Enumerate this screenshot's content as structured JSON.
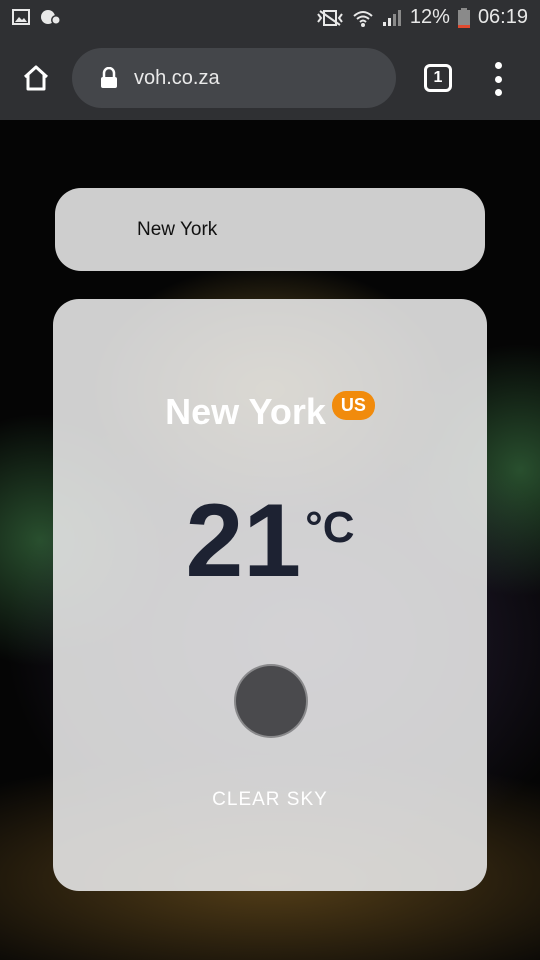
{
  "status_bar": {
    "battery": "12%",
    "time": "06:19",
    "icons": [
      "image-icon",
      "notification-icon",
      "vibrate-icon",
      "wifi-icon",
      "signal-icon",
      "battery-icon"
    ]
  },
  "browser": {
    "url": "voh.co.za",
    "tab_count": "1",
    "icons": [
      "home-icon",
      "lock-icon",
      "tabs-icon",
      "menu-icon"
    ]
  },
  "search": {
    "value": "New York"
  },
  "weather": {
    "city": "New York",
    "country": "US",
    "temperature": "21",
    "unit": "°C",
    "condition": "CLEAR SKY",
    "icon": "weather-icon"
  },
  "colors": {
    "browser_bg": "#2f3033",
    "address_bg": "#44464a",
    "badge": "#f18b0c",
    "temperature": "#1d2232"
  }
}
